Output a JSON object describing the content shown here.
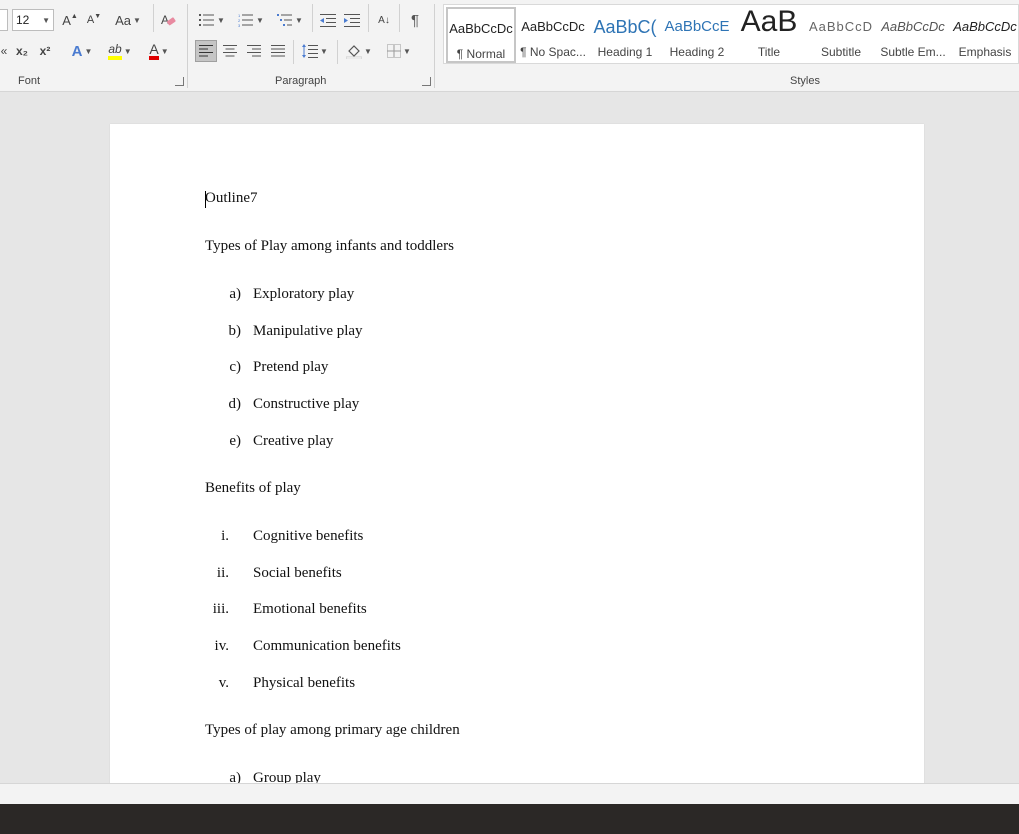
{
  "font": {
    "size_value": "12",
    "group_label": "Font",
    "buttons": {
      "grow": "A",
      "shrink": "A",
      "change_case": "Aa",
      "clear_format": "A",
      "partial": "«",
      "subscript": "x₂",
      "superscript": "x²",
      "text_effects": "A",
      "highlight": "ab",
      "font_color": "A"
    },
    "colors": {
      "highlight": "#ffff00",
      "font_color": "#e00000",
      "text_effects": "#4a7bd0"
    }
  },
  "paragraph": {
    "group_label": "Paragraph",
    "pilcrow": "¶",
    "sort": "A↓"
  },
  "styles": {
    "group_label": "Styles",
    "items": [
      {
        "sample": "AaBbCcDc",
        "name": "¶ Normal"
      },
      {
        "sample": "AaBbCcDc",
        "name": "¶ No Spac..."
      },
      {
        "sample": "AaBbC(",
        "name": "Heading 1"
      },
      {
        "sample": "AaBbCcE",
        "name": "Heading 2"
      },
      {
        "sample": "AaB",
        "name": "Title"
      },
      {
        "sample": "AaBbCcD",
        "name": "Subtitle"
      },
      {
        "sample": "AaBbCcDc",
        "name": "Subtle Em..."
      },
      {
        "sample": "AaBbCcDc",
        "name": "Emphasis"
      }
    ]
  },
  "document": {
    "title": "Outline7",
    "section1": {
      "heading": "Types of Play among infants and toddlers",
      "items": [
        {
          "marker": "a)",
          "text": "Exploratory play"
        },
        {
          "marker": "b)",
          "text": "Manipulative play"
        },
        {
          "marker": "c)",
          "text": "Pretend play"
        },
        {
          "marker": "d)",
          "text": "Constructive play"
        },
        {
          "marker": "e)",
          "text": "Creative play"
        }
      ]
    },
    "section2": {
      "heading": "Benefits of play",
      "items": [
        {
          "marker": "i.",
          "text": "Cognitive benefits"
        },
        {
          "marker": "ii.",
          "text": "Social benefits"
        },
        {
          "marker": "iii.",
          "text": "Emotional benefits"
        },
        {
          "marker": "iv.",
          "text": "Communication benefits"
        },
        {
          "marker": "v.",
          "text": "Physical benefits"
        }
      ]
    },
    "section3": {
      "heading": "Types of play among primary age children",
      "items": [
        {
          "marker": "a)",
          "text": "Group play"
        }
      ]
    }
  }
}
